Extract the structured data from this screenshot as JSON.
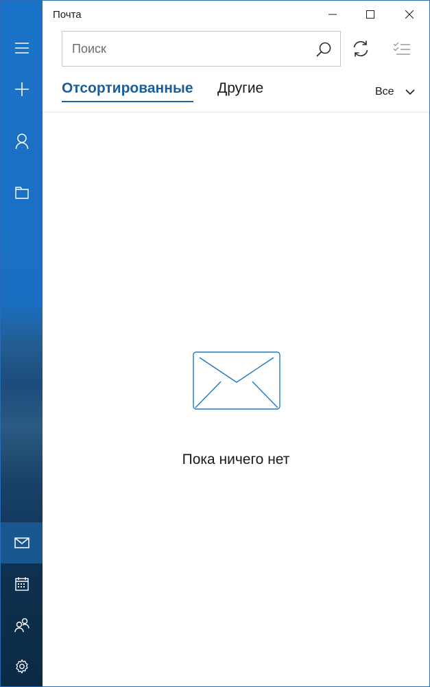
{
  "window": {
    "title": "Почта"
  },
  "search": {
    "placeholder": "Поиск",
    "value": ""
  },
  "tabs": [
    {
      "label": "Отсортированные",
      "selected": true
    },
    {
      "label": "Другие",
      "selected": false
    }
  ],
  "filter": {
    "label": "Все"
  },
  "empty_state": {
    "message": "Пока ничего нет",
    "icon": "envelope-icon"
  },
  "nav_rail": {
    "top_icons": [
      "hamburger-icon",
      "plus-icon",
      "person-icon",
      "folder-icon"
    ],
    "bottom_icons": [
      "mail-icon",
      "calendar-icon",
      "people-icon",
      "gear-icon"
    ],
    "active": "mail-icon"
  },
  "colors": {
    "accent": "#1a5e9e",
    "rail": "#1a72c8",
    "envelope_stroke": "#1a78c8"
  }
}
